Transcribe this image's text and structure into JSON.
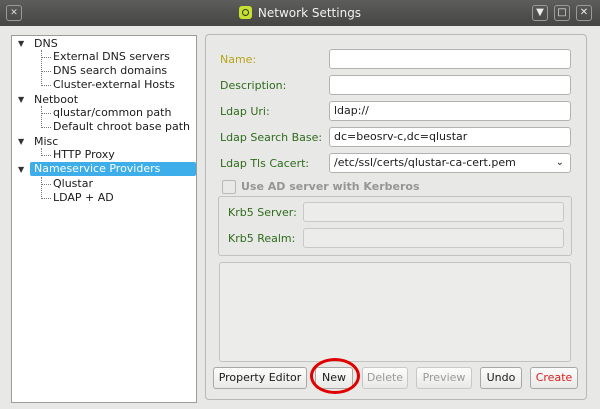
{
  "window": {
    "title": "Network Settings",
    "controls": {
      "minimize": "▼",
      "maximize": "□",
      "close": "✕"
    }
  },
  "tree": {
    "nodes": [
      {
        "label": "DNS",
        "children": [
          "External DNS servers",
          "DNS search domains",
          "Cluster-external Hosts"
        ]
      },
      {
        "label": "Netboot",
        "children": [
          "qlustar/common path",
          "Default chroot base path"
        ]
      },
      {
        "label": "Misc",
        "children": [
          "HTTP Proxy"
        ]
      },
      {
        "label": "Nameservice Providers",
        "selected": true,
        "children": [
          "Qlustar",
          "LDAP + AD"
        ]
      }
    ]
  },
  "form": {
    "name": {
      "label": "Name:",
      "value": ""
    },
    "description": {
      "label": "Description:",
      "value": ""
    },
    "ldap_uri": {
      "label": "Ldap Uri:",
      "value": "ldap://"
    },
    "ldap_search_base": {
      "label": "Ldap Search Base:",
      "value": "dc=beosrv-c,dc=qlustar"
    },
    "ldap_tls_cacert": {
      "label": "Ldap Tls Cacert:",
      "value": "/etc/ssl/certs/qlustar-ca-cert.pem"
    },
    "use_ad": {
      "label": "Use AD server with Kerberos",
      "checked": false
    },
    "krb5_server": {
      "label": "Krb5 Server:",
      "value": ""
    },
    "krb5_realm": {
      "label": "Krb5 Realm:",
      "value": ""
    }
  },
  "buttons": {
    "property_editor": "Property Editor",
    "new": "New",
    "delete": "Delete",
    "preview": "Preview",
    "undo": "Undo",
    "create": "Create"
  },
  "colors": {
    "label_green": "#2e6b1c",
    "label_warning": "#b8a51a",
    "highlight": "#3daee9",
    "annotation": "#e00000"
  }
}
